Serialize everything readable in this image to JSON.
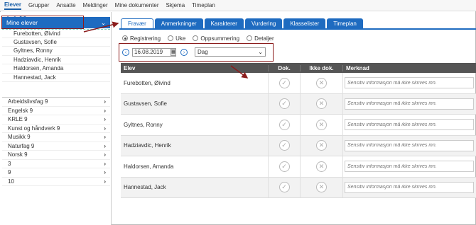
{
  "topnav": {
    "items": [
      "Elever",
      "Grupper",
      "Ansatte",
      "Meldinger",
      "Mine dokumenter",
      "Skjema",
      "Timeplan"
    ]
  },
  "sidebar": {
    "mine_elever": "Mine elever",
    "students": [
      "Furebotten, Øivind",
      "Gustavsen, Sofie",
      "Gyltnes, Ronny",
      "Hadziavdic, Henrik",
      "Haldorsen, Amanda",
      "Hannestad, Jack"
    ],
    "groups": [
      "Arbeidslivsfag 9",
      "Engelsk 9",
      "KRLE 9",
      "Kunst og håndverk 9",
      "Musikk 9",
      "Naturfag 9",
      "Norsk 9",
      "3",
      "9",
      "10"
    ]
  },
  "tabs": [
    "Fravær",
    "Anmerkninger",
    "Karakterer",
    "Vurdering",
    "Klasselister",
    "Timeplan"
  ],
  "modes": [
    "Registrering",
    "Uke",
    "Oppsummering",
    "Detaljer"
  ],
  "date": "16.08.2019",
  "period": "Dag",
  "table": {
    "headers": [
      "Elev",
      "Dok.",
      "Ikke dok.",
      "Merknad"
    ],
    "rows": [
      "Furebotten, Øivind",
      "Gustavsen, Sofie",
      "Gyltnes, Ronny",
      "Hadziavdic, Henrik",
      "Haldorsen, Amanda",
      "Hannestad, Jack"
    ],
    "remark_placeholder": "Sensitiv informasjon må ikke skrives inn."
  },
  "colors": {
    "accent": "#1e6bc0",
    "annotation": "#8b1c1c",
    "header": "#555555"
  }
}
